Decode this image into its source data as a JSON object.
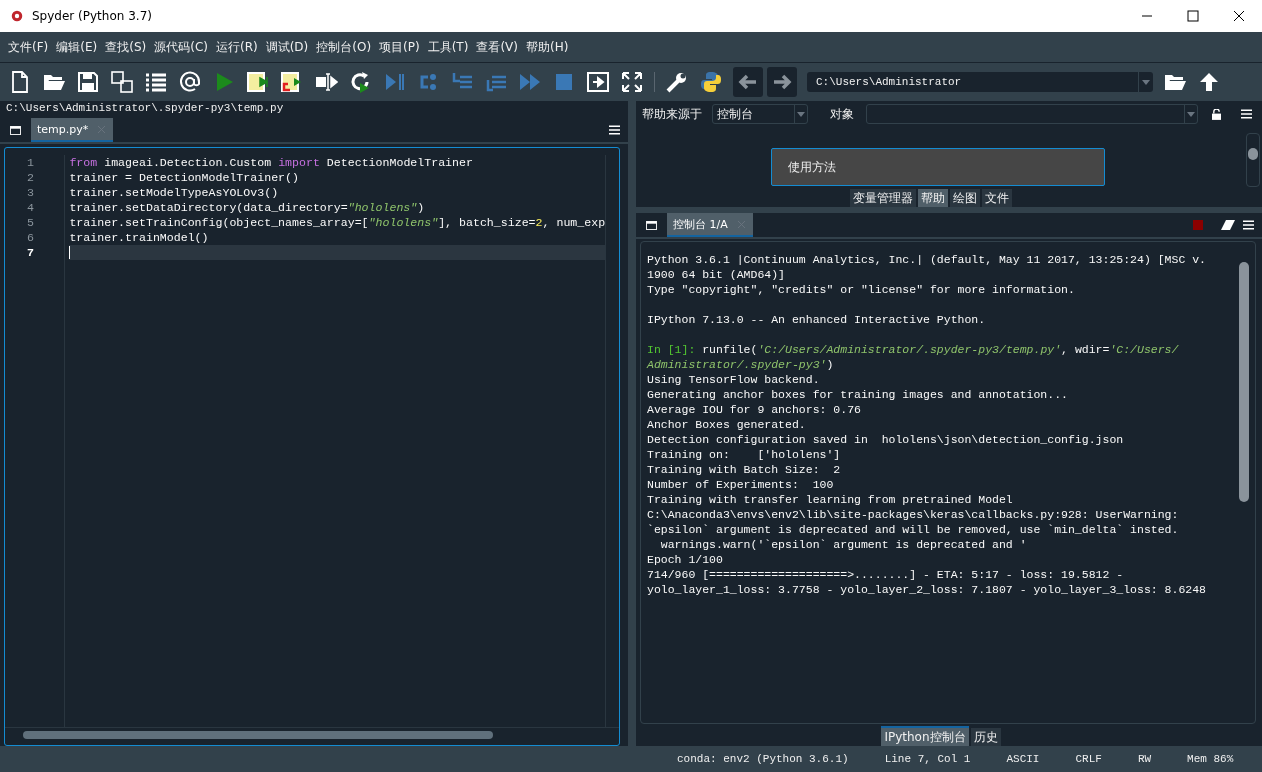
{
  "window": {
    "title": "Spyder (Python 3.7)"
  },
  "menu": [
    "文件(F)",
    "编辑(E)",
    "查找(S)",
    "源代码(C)",
    "运行(R)",
    "调试(D)",
    "控制台(O)",
    "项目(P)",
    "工具(T)",
    "查看(V)",
    "帮助(H)"
  ],
  "path_toolbar": {
    "directory": "C:\\Users\\Administrator"
  },
  "editor": {
    "file_path": "C:\\Users\\Administrator\\.spyder-py3\\temp.py",
    "tabs": [
      {
        "label": "temp.py*",
        "selected": true
      }
    ],
    "lines": [
      {
        "number": "1",
        "current": false,
        "segments": [
          {
            "kind": "keyword",
            "text": "from"
          },
          {
            "kind": "plain",
            "text": " imageai.Detection.Custom "
          },
          {
            "kind": "keyword",
            "text": "import"
          },
          {
            "kind": "plain",
            "text": " DetectionModelTrainer"
          }
        ]
      },
      {
        "number": "2",
        "current": false,
        "segments": [
          {
            "kind": "plain",
            "text": "trainer = DetectionModelTrainer()"
          }
        ]
      },
      {
        "number": "3",
        "current": false,
        "segments": [
          {
            "kind": "plain",
            "text": "trainer.setModelTypeAsYOLOv3()"
          }
        ]
      },
      {
        "number": "4",
        "current": false,
        "segments": [
          {
            "kind": "plain",
            "text": "trainer.setDataDirectory(data_directory="
          },
          {
            "kind": "string",
            "text": "\"hololens\""
          },
          {
            "kind": "plain",
            "text": ")"
          }
        ]
      },
      {
        "number": "5",
        "current": false,
        "segments": [
          {
            "kind": "plain",
            "text": "trainer.setTrainConfig(object_names_array=["
          },
          {
            "kind": "string",
            "text": "\"hololens\""
          },
          {
            "kind": "plain",
            "text": "], batch_size="
          },
          {
            "kind": "number",
            "text": "2"
          },
          {
            "kind": "plain",
            "text": ", num_exp"
          }
        ]
      },
      {
        "number": "6",
        "current": false,
        "segments": [
          {
            "kind": "plain",
            "text": "trainer.trainModel()"
          }
        ]
      },
      {
        "number": "7",
        "current": true
      }
    ]
  },
  "help": {
    "source_label": "帮助来源于",
    "source": "控制台",
    "object_label": "对象",
    "usage_title": "使用方法"
  },
  "top_tabs": [
    {
      "label": "变量管理器",
      "selected": false
    },
    {
      "label": "帮助",
      "selected": true
    },
    {
      "label": "绘图",
      "selected": false
    },
    {
      "label": "文件",
      "selected": false
    }
  ],
  "console": {
    "tabs": [
      {
        "label": "控制台 1/A",
        "selected": true
      }
    ],
    "blocks": [
      {
        "lines": [
          [
            {
              "kind": "plain",
              "text": "Python 3.6.1 |Continuum Analytics, Inc.| (default, May 11 2017, 13:25:24) [MSC v."
            }
          ],
          [
            {
              "kind": "plain",
              "text": "1900 64 bit (AMD64)]"
            }
          ],
          [
            {
              "kind": "plain",
              "text": "Type \"copyright\", \"credits\" or \"license\" for more information."
            }
          ]
        ]
      },
      {
        "lines": [
          [
            {
              "kind": "plain",
              "text": "IPython 7.13.0 -- An enhanced Interactive Python."
            }
          ]
        ]
      },
      {
        "lines": [
          [
            {
              "kind": "prompt",
              "text": "In [1]:"
            },
            {
              "kind": "plain",
              "text": " runfile("
            },
            {
              "kind": "string",
              "text": "'C:/Users/Administrator/.spyder-py3/temp.py'"
            },
            {
              "kind": "plain",
              "text": ", wdir="
            },
            {
              "kind": "string",
              "text": "'C:/Users/"
            }
          ],
          [
            {
              "kind": "string",
              "text": "Administrator/.spyder-py3'"
            },
            {
              "kind": "plain",
              "text": ")"
            }
          ],
          [
            {
              "kind": "plain",
              "text": "Using TensorFlow backend."
            }
          ],
          [
            {
              "kind": "plain",
              "text": "Generating anchor boxes for training images and annotation..."
            }
          ],
          [
            {
              "kind": "plain",
              "text": "Average IOU for 9 anchors: 0.76"
            }
          ],
          [
            {
              "kind": "plain",
              "text": "Anchor Boxes generated."
            }
          ],
          [
            {
              "kind": "plain",
              "text": "Detection configuration saved in  hololens\\json\\detection_config.json"
            }
          ],
          [
            {
              "kind": "plain",
              "text": "Training on: \t['hololens']"
            }
          ],
          [
            {
              "kind": "plain",
              "text": "Training with Batch Size:  2"
            }
          ],
          [
            {
              "kind": "plain",
              "text": "Number of Experiments:  100"
            }
          ],
          [
            {
              "kind": "plain",
              "text": "Training with transfer learning from pretrained Model"
            }
          ],
          [
            {
              "kind": "plain",
              "text": "C:\\Anaconda3\\envs\\env2\\lib\\site-packages\\keras\\callbacks.py:928: UserWarning:"
            }
          ],
          [
            {
              "kind": "plain",
              "text": "`epsilon` argument is deprecated and will be removed, use `min_delta` insted."
            }
          ],
          [
            {
              "kind": "plain",
              "text": "  warnings.warn('`epsilon` argument is deprecated and '"
            }
          ],
          [
            {
              "kind": "plain",
              "text": "Epoch 1/100"
            }
          ],
          [
            {
              "kind": "plain",
              "text": "714/960 [====================>........] - ETA: 5:17 - loss: 19.5812 -"
            }
          ],
          [
            {
              "kind": "plain",
              "text": "yolo_layer_1_loss: 3.7758 - yolo_layer_2_loss: 7.1807 - yolo_layer_3_loss: 8.6248"
            }
          ]
        ]
      }
    ]
  },
  "bottom_tabs": [
    {
      "label": "IPython控制台",
      "selected": true
    },
    {
      "label": "历史",
      "selected": false
    }
  ],
  "status_bar": {
    "env": "conda: env2 (Python 3.6.1)",
    "position": "Line 7, Col 1",
    "encoding": "ASCII",
    "eol": "CRLF",
    "permissions": "RW",
    "memory": "Mem 86%"
  }
}
